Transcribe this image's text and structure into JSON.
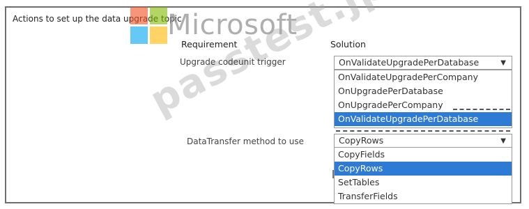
{
  "panel": {
    "title": "Actions to set up the data upgrade topic"
  },
  "watermarks": {
    "brand": "Microsoft",
    "site": "passtest.jp"
  },
  "columns": {
    "requirement": "Requirement",
    "solution": "Solution"
  },
  "rows": [
    {
      "label": "Upgrade codeunit trigger",
      "selected_value": "OnValidateUpgradePerDatabase",
      "options": [
        "OnValidateUpgradePerCompany",
        "OnUpgradePerDatabase",
        "OnUpgradePerCompany",
        "OnValidateUpgradePerDatabase"
      ],
      "highlighted_index": 3
    },
    {
      "label": "DataTransfer method to use",
      "selected_value": "CopyRows",
      "options": [
        "CopyFields",
        "CopyRows",
        "SetTables",
        "TransferFields"
      ],
      "highlighted_index": 1
    }
  ],
  "icons": {
    "dropdown": "caret-down-icon"
  },
  "colors": {
    "highlight": "#2e7bd6",
    "highlight_text": "#ffffff",
    "border": "#9a9a9a"
  }
}
